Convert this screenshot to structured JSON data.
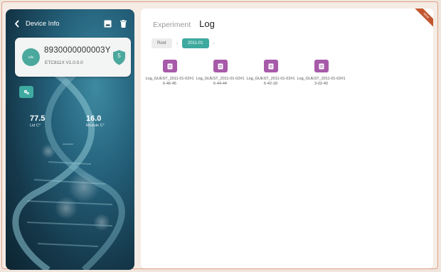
{
  "device_panel": {
    "title": "Device Info",
    "icons": {
      "back": "chevron-left-icon",
      "image": "image-icon",
      "delete": "trash-icon"
    },
    "device_card": {
      "status": "Idle",
      "device_id": "8930000000003Y",
      "model_version": "ETC811X  V1.0.0.0",
      "badge_number": "5"
    },
    "action_icon": "settings-icon",
    "readings": [
      {
        "value": "77.5",
        "label": "Lid C°"
      },
      {
        "value": "16.0",
        "label": "Module C°"
      }
    ]
  },
  "main_panel": {
    "tabs": [
      {
        "label": "Experiment",
        "active": false
      },
      {
        "label": "Log",
        "active": true
      }
    ],
    "breadcrumb": {
      "root": "Root",
      "current": "2011-01"
    },
    "files": [
      "Log_GUEST_2011-01-02#16-46-45",
      "Log_GUEST_2011-01-02#16-44-44",
      "Log_GUEST_2011-01-02#16-42-18",
      "Log_GUEST_2011-01-02#13-02-40"
    ],
    "corner_ribbon": "NEW"
  },
  "colors": {
    "accent_teal": "#3ea99f",
    "file_purple": "#a75aa9",
    "panel_dark": "#15394b",
    "ribbon": "#c2572f"
  }
}
